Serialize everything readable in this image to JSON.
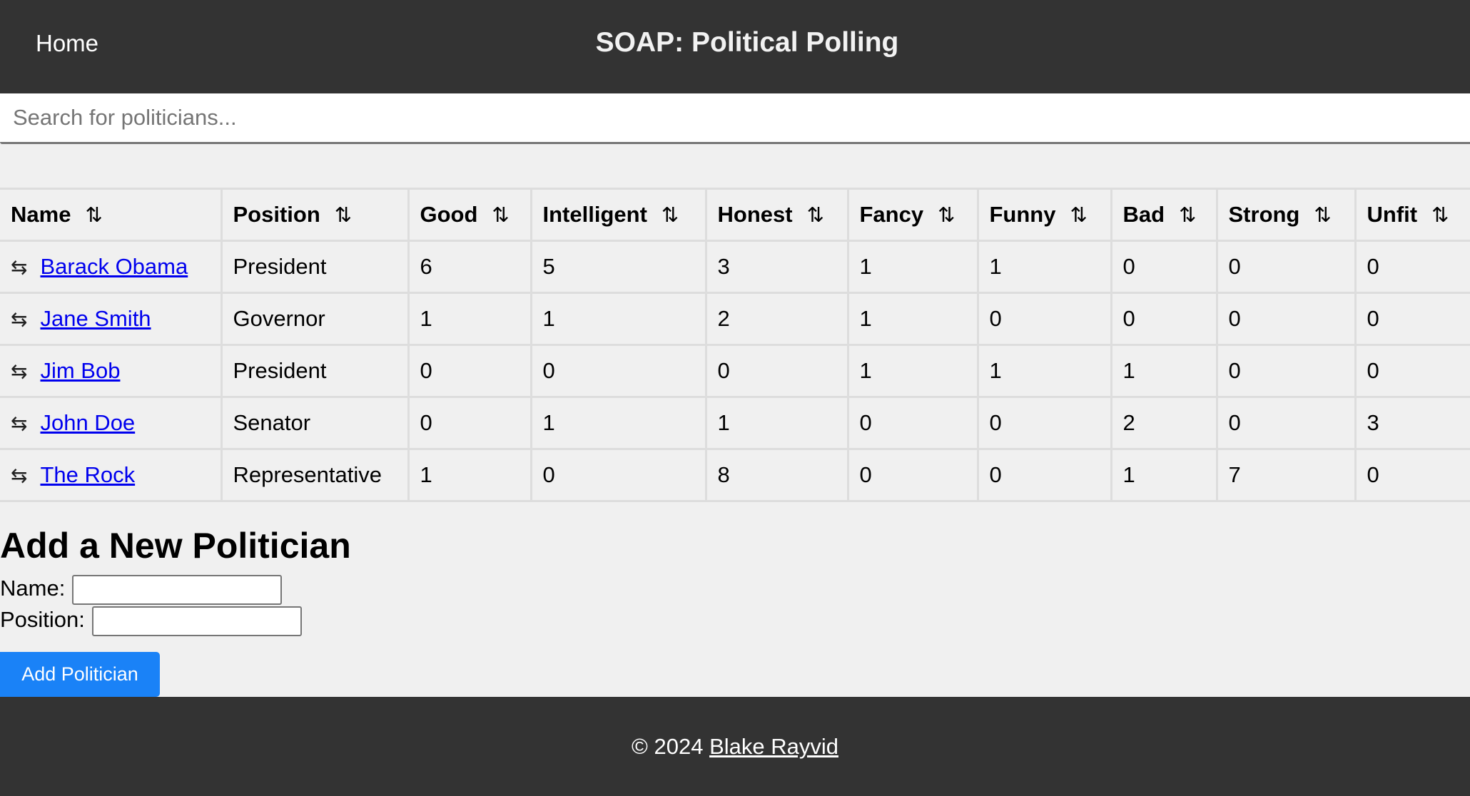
{
  "header": {
    "home_label": "Home",
    "title": "SOAP: Political Polling"
  },
  "search": {
    "placeholder": "Search for politicians...",
    "value": ""
  },
  "table": {
    "sort_icon": "⇅",
    "drag_icon": "⇆",
    "columns": [
      "Name",
      "Position",
      "Good",
      "Intelligent",
      "Honest",
      "Fancy",
      "Funny",
      "Bad",
      "Strong",
      "Unfit"
    ],
    "rows": [
      {
        "name": "Barack Obama",
        "position": "President",
        "scores": [
          "6",
          "5",
          "3",
          "1",
          "1",
          "0",
          "0",
          "0"
        ]
      },
      {
        "name": "Jane Smith",
        "position": "Governor",
        "scores": [
          "1",
          "1",
          "2",
          "1",
          "0",
          "0",
          "0",
          "0"
        ]
      },
      {
        "name": "Jim Bob",
        "position": "President",
        "scores": [
          "0",
          "0",
          "0",
          "1",
          "1",
          "1",
          "0",
          "0"
        ]
      },
      {
        "name": "John Doe",
        "position": "Senator",
        "scores": [
          "0",
          "1",
          "1",
          "0",
          "0",
          "2",
          "0",
          "3"
        ]
      },
      {
        "name": "The Rock",
        "position": "Representative",
        "scores": [
          "1",
          "0",
          "8",
          "0",
          "0",
          "1",
          "7",
          "0"
        ]
      }
    ]
  },
  "add_form": {
    "heading": "Add a New Politician",
    "name_label": "Name:",
    "name_value": "",
    "position_label": "Position:",
    "position_value": "",
    "submit_label": "Add Politician"
  },
  "footer": {
    "copyright": "© 2024",
    "author": "Blake Rayvid"
  },
  "colors": {
    "header_bg": "#333333",
    "accent_button": "#1a82f7",
    "link": "#0000ee",
    "page_bg": "#f0f0f0"
  }
}
